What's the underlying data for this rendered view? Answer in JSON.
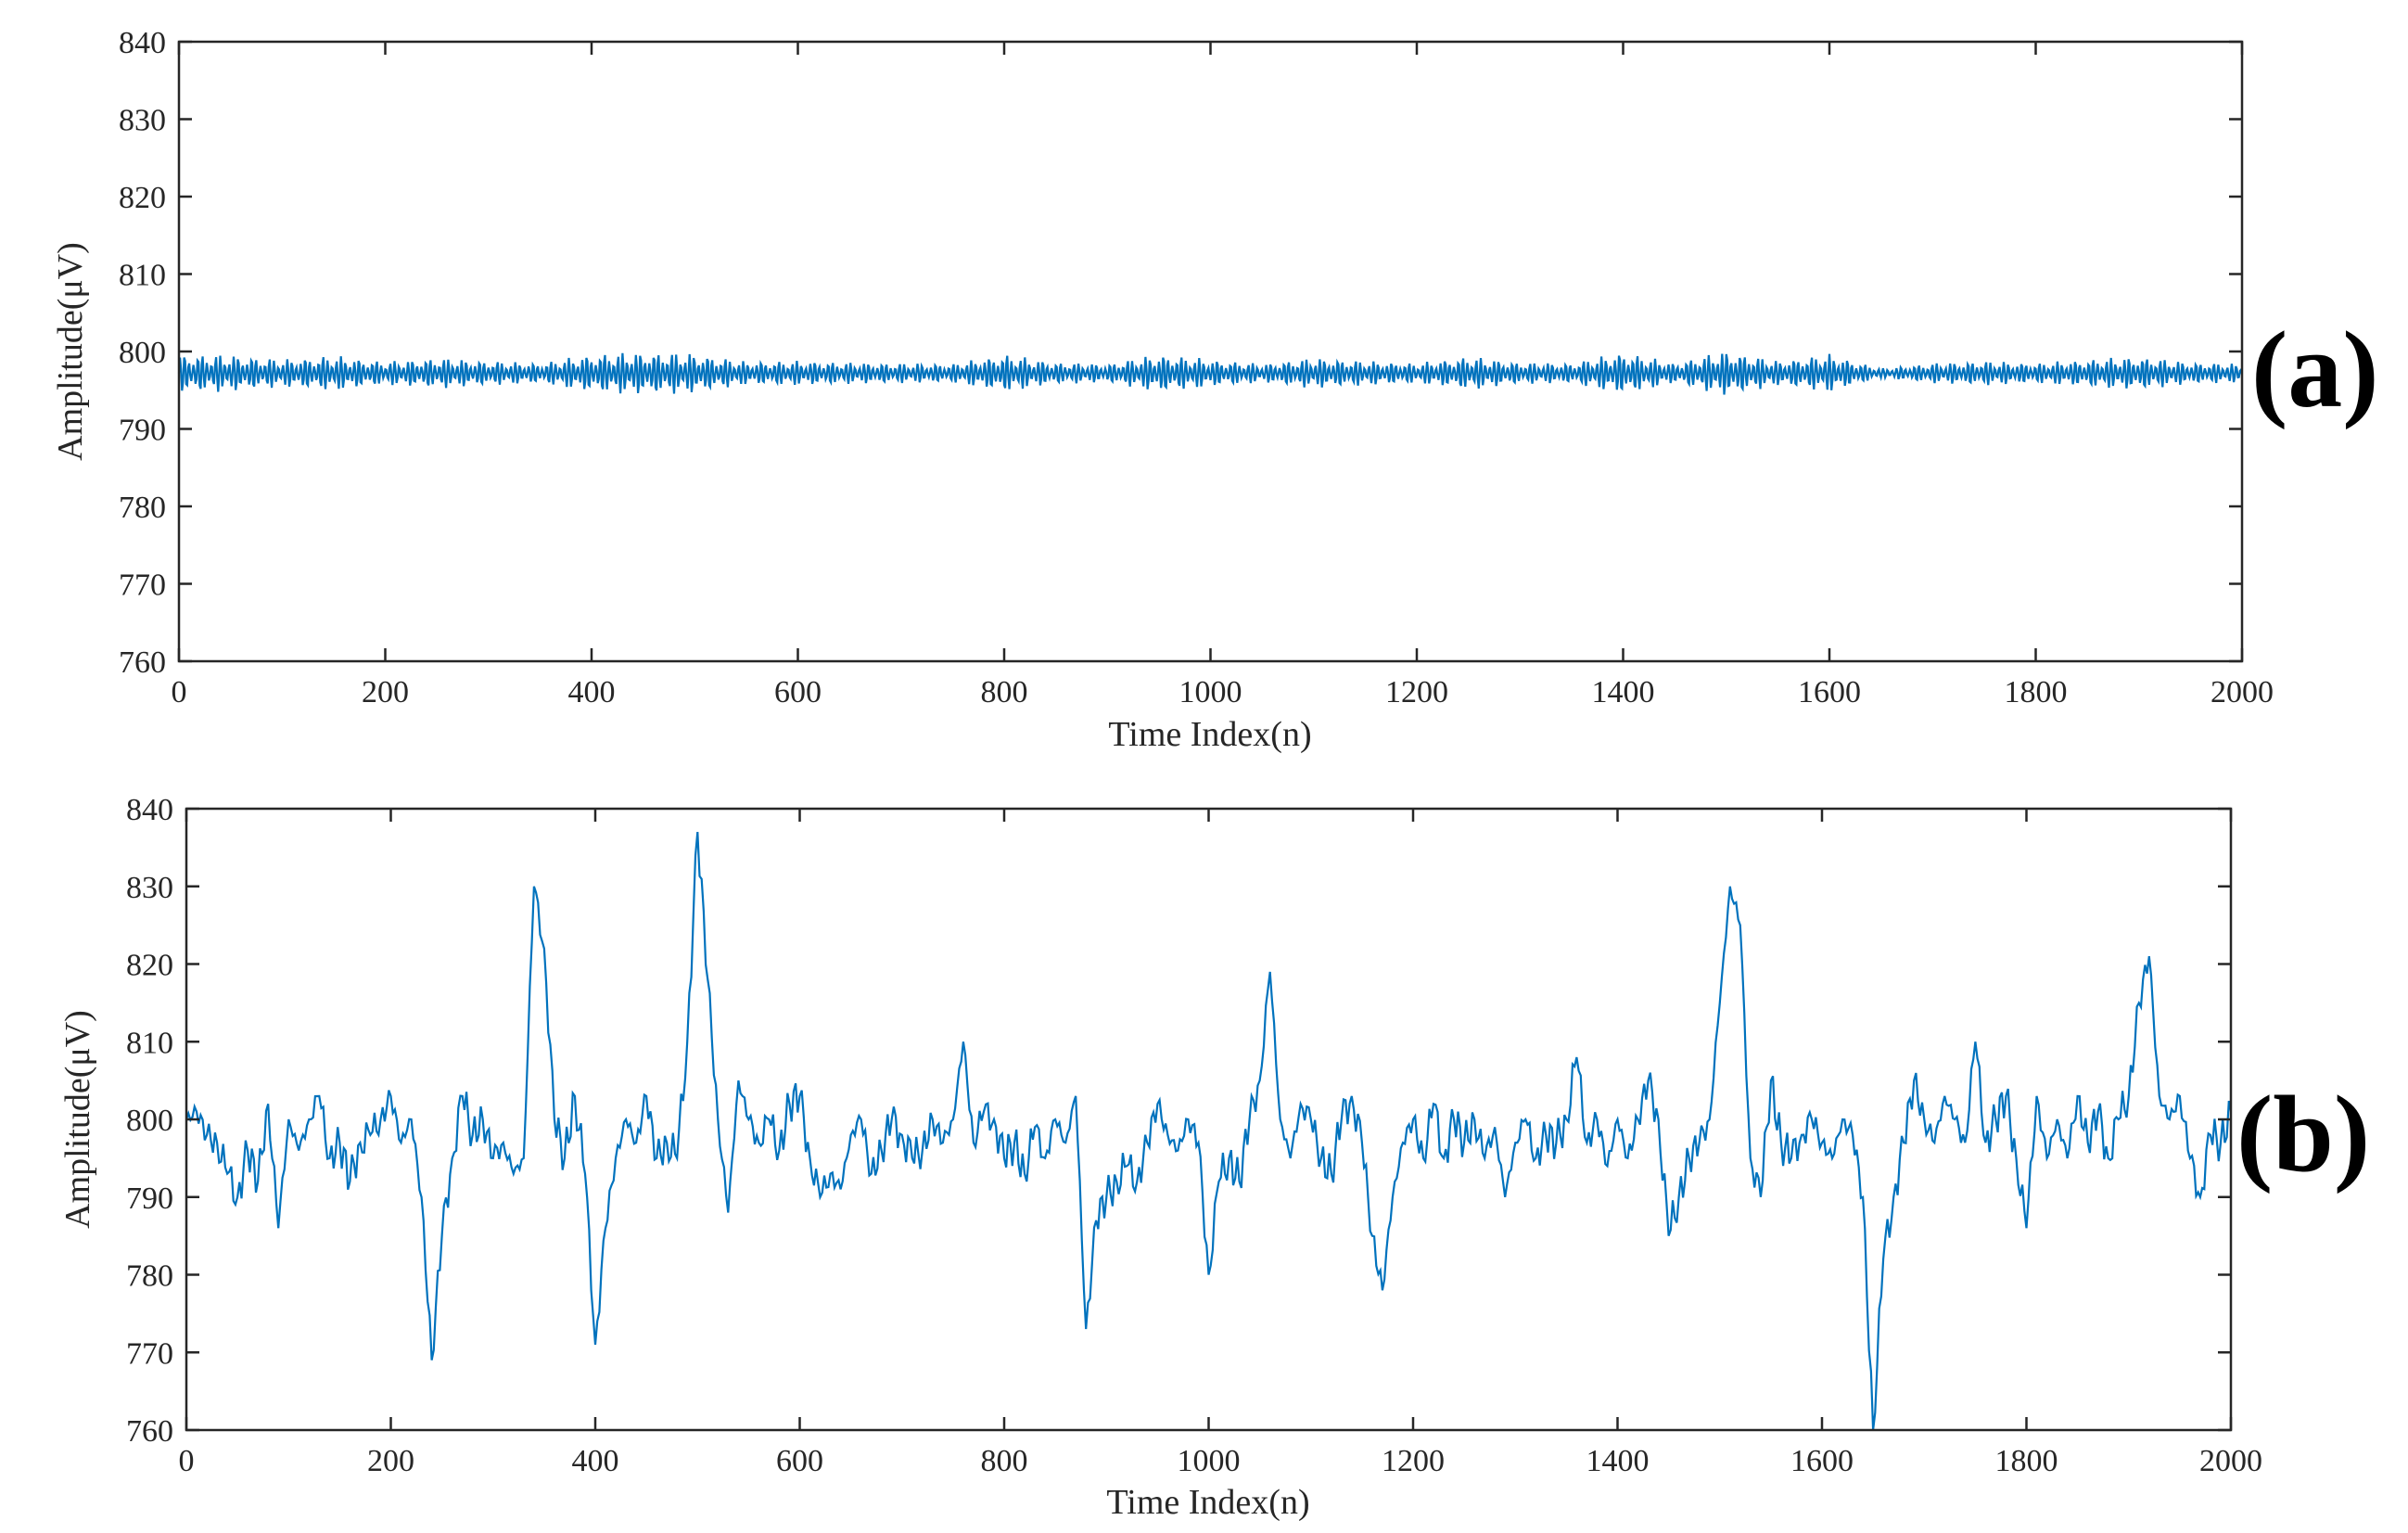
{
  "chart_data": [
    {
      "type": "line",
      "panel_label": "(a)",
      "xlabel": "Time Index(n)",
      "ylabel": "Amplitude(μV)",
      "xlim": [
        0,
        2000
      ],
      "ylim": [
        760,
        840
      ],
      "xticks": [
        "0",
        "200",
        "400",
        "600",
        "800",
        "1000",
        "1200",
        "1400",
        "1600",
        "1800",
        "2000"
      ],
      "yticks": [
        "760",
        "770",
        "780",
        "790",
        "800",
        "810",
        "820",
        "830",
        "840"
      ],
      "color": "#0072BD",
      "grid": false,
      "series_model": {
        "description": "oscillation around mean with varying envelope",
        "mean": 797.2,
        "envelope_step": 50,
        "envelope": [
          2.5,
          2.4,
          1.8,
          2.3,
          1.5,
          2.0,
          1.6,
          1.3,
          2.5,
          2.8,
          2.6,
          1.5,
          1.6,
          1.4,
          1.3,
          1.2,
          2.5,
          1.4,
          1.2,
          2.5,
          1.8,
          1.2,
          2.0,
          1.6,
          1.3,
          2.2,
          1.4,
          1.3,
          2.8,
          1.3,
          3.0,
          1.6,
          2.5,
          0.6,
          1.3,
          1.6,
          1.3,
          1.8,
          2.2,
          1.4,
          1.2
        ]
      }
    },
    {
      "type": "line",
      "panel_label": "(b)",
      "xlabel": "Time Index(n)",
      "ylabel": "Amplitude(μV)",
      "xlim": [
        0,
        2000
      ],
      "ylim": [
        760,
        840
      ],
      "xticks": [
        "0",
        "200",
        "400",
        "600",
        "800",
        "1000",
        "1200",
        "1400",
        "1600",
        "1800",
        "2000"
      ],
      "yticks": [
        "760",
        "770",
        "780",
        "790",
        "800",
        "810",
        "820",
        "830",
        "840"
      ],
      "color": "#0072BD",
      "grid": false,
      "x_step": 10,
      "values": [
        800,
        801,
        798,
        797,
        793,
        790,
        796,
        792,
        802,
        786,
        800,
        796,
        800,
        803,
        795,
        797,
        792,
        797,
        798,
        800,
        803,
        797,
        800,
        790,
        769,
        785,
        795,
        803,
        798,
        800,
        795,
        797,
        793,
        795,
        830,
        822,
        800,
        795,
        803,
        793,
        771,
        786,
        795,
        800,
        797,
        803,
        795,
        797,
        795,
        810,
        837,
        818,
        800,
        788,
        805,
        800,
        797,
        800,
        796,
        802,
        803,
        795,
        790,
        793,
        791,
        798,
        800,
        793,
        796,
        800,
        798,
        795,
        796,
        800,
        797,
        800,
        810,
        797,
        801,
        800,
        795,
        797,
        793,
        799,
        795,
        800,
        797,
        803,
        773,
        787,
        790,
        792,
        794,
        792,
        797,
        802,
        798,
        796,
        800,
        797,
        780,
        792,
        795,
        792,
        800,
        805,
        819,
        800,
        795,
        802,
        800,
        795,
        793,
        800,
        803,
        797,
        785,
        778,
        790,
        797,
        800,
        795,
        802,
        795,
        800,
        797,
        800,
        795,
        799,
        790,
        797,
        800,
        795,
        798,
        797,
        800,
        808,
        797,
        800,
        794,
        800,
        795,
        800,
        805,
        800,
        785,
        790,
        795,
        797,
        800,
        815,
        830,
        825,
        795,
        790,
        805,
        797,
        795,
        798,
        800,
        797,
        795,
        800,
        798,
        790,
        760,
        782,
        790,
        797,
        805,
        800,
        797,
        803,
        800,
        797,
        810,
        797,
        800,
        803,
        795,
        786,
        803,
        795,
        800,
        795,
        803,
        797,
        801,
        795,
        800,
        803,
        815,
        821,
        803,
        800,
        803,
        795,
        790,
        798,
        797,
        801
      ]
    }
  ]
}
